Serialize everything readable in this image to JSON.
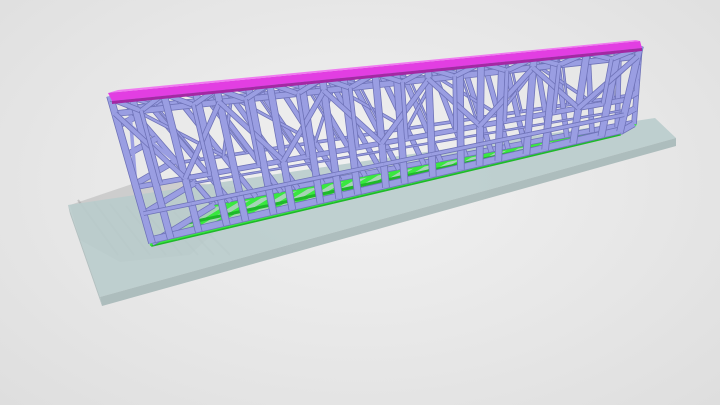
{
  "scene": {
    "background_color": "#e9e9e9",
    "slab_color": "#b9cccc",
    "slab_edge_color": "#a6b8b8",
    "frame_color": "#9a9ee2",
    "frame_edge_color": "#6f73b8",
    "floor_color": "#39e83f",
    "floor_dark_color": "#1fb82a",
    "top_plate_color": "#e23ee2",
    "shadow_color": "#9a9a9a",
    "icon": "steel-wall-frame-3d-model"
  }
}
